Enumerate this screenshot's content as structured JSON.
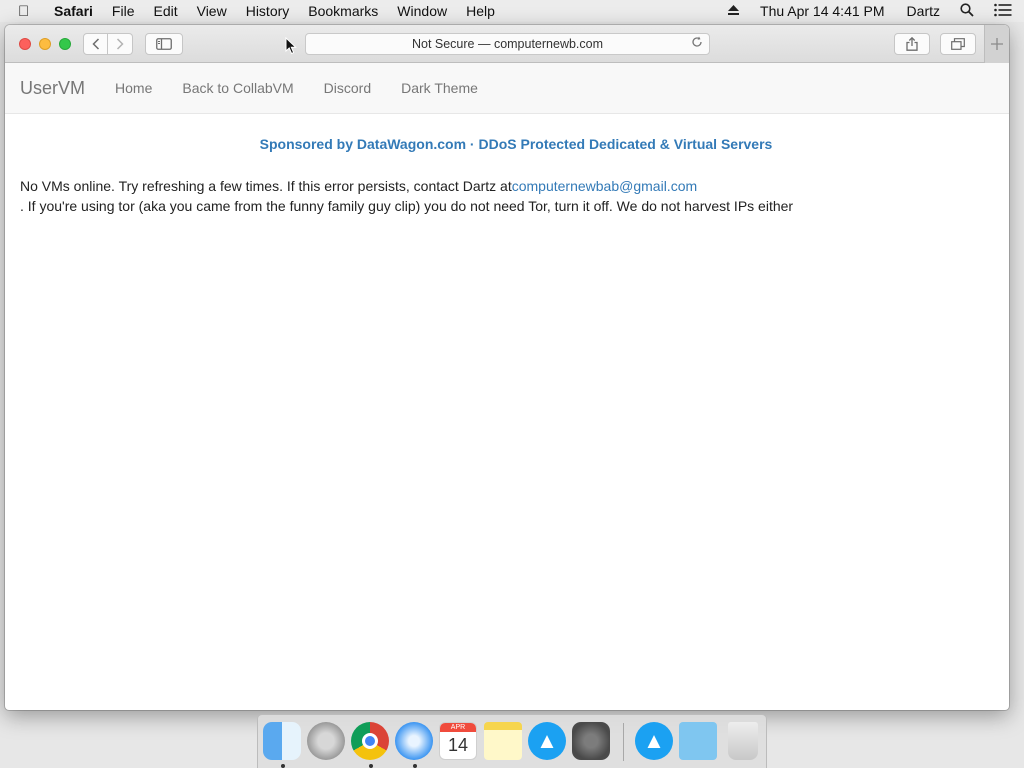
{
  "menubar": {
    "app": "Safari",
    "items": [
      "File",
      "Edit",
      "View",
      "History",
      "Bookmarks",
      "Window",
      "Help"
    ],
    "clock": "Thu Apr 14  4:41 PM",
    "user": "Dartz"
  },
  "browser": {
    "address": "Not Secure — computernewb.com"
  },
  "page": {
    "brand": "UserVM",
    "nav": [
      "Home",
      "Back to CollabVM",
      "Discord",
      "Dark Theme"
    ],
    "sponsor": "Sponsored by DataWagon.com · DDoS Protected Dedicated & Virtual Servers",
    "message_prefix": "No VMs online. Try refreshing a few times. If this error persists, contact Dartz at",
    "message_email": "computernewbab@gmail.com",
    "message_suffix": ". If you're using tor (aka you came from the funny family guy clip) you do not need Tor, turn it off. We do not harvest IPs either"
  },
  "dock": {
    "calendar_month": "APR",
    "calendar_day": "14",
    "apps": [
      "finder-icon",
      "launchpad-icon",
      "chrome-icon",
      "safari-icon",
      "calendar-icon",
      "notes-icon",
      "app-store-icon",
      "system-preferences-icon",
      "app-store-icon",
      "downloads-folder-icon",
      "trash-icon"
    ]
  }
}
